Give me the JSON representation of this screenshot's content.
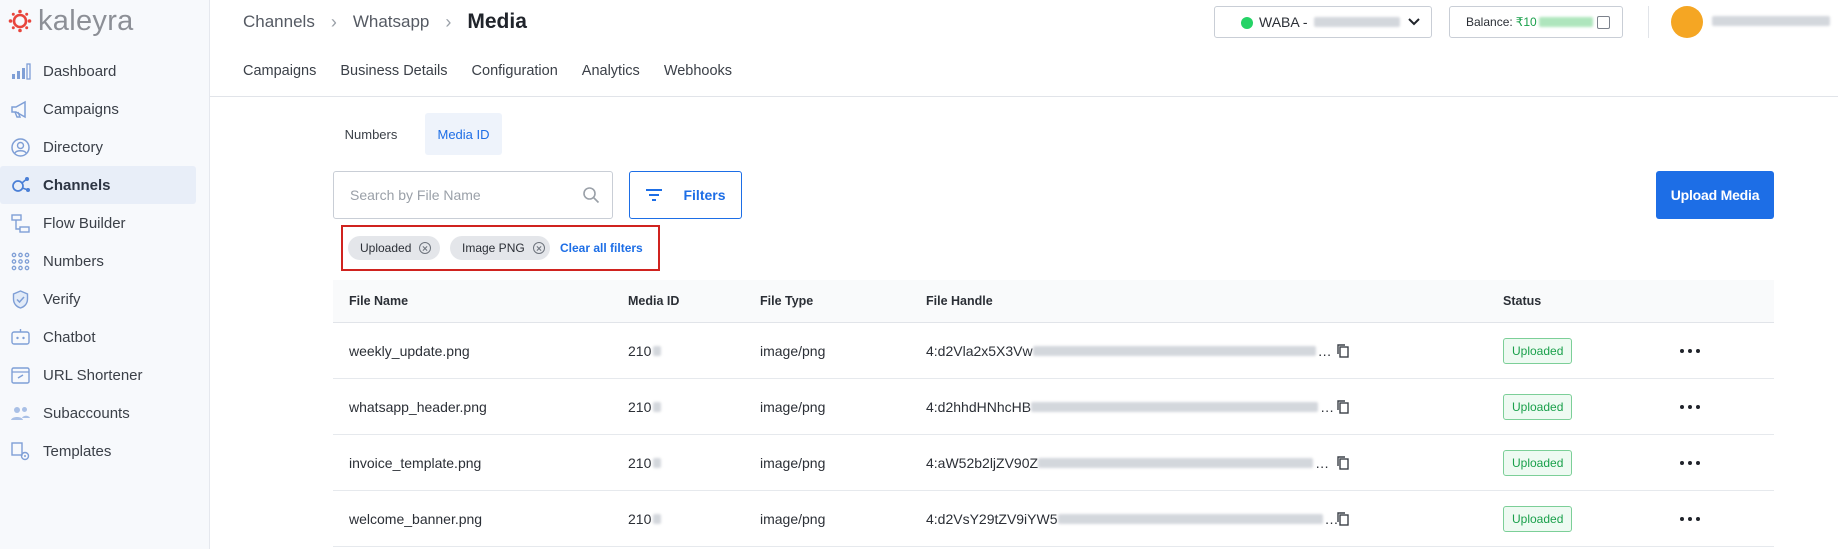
{
  "brand": {
    "name": "kaleyra"
  },
  "sidebar": {
    "items": [
      {
        "label": "Dashboard",
        "icon": "bar-chart-icon"
      },
      {
        "label": "Campaigns",
        "icon": "megaphone-icon"
      },
      {
        "label": "Directory",
        "icon": "person-circle-icon"
      },
      {
        "label": "Channels",
        "icon": "channels-icon",
        "active": true
      },
      {
        "label": "Flow Builder",
        "icon": "flow-icon"
      },
      {
        "label": "Numbers",
        "icon": "dial-grid-icon"
      },
      {
        "label": "Verify",
        "icon": "shield-check-icon"
      },
      {
        "label": "Chatbot",
        "icon": "chatbot-icon"
      },
      {
        "label": "URL Shortener",
        "icon": "link-icon"
      },
      {
        "label": "Subaccounts",
        "icon": "users-icon"
      },
      {
        "label": "Templates",
        "icon": "template-gear-icon"
      }
    ]
  },
  "header": {
    "breadcrumb": [
      "Channels",
      "Whatsapp"
    ],
    "title": "Media",
    "waba_label": "WABA -",
    "balance_label": "Balance:",
    "balance_prefix": "₹10"
  },
  "top_tabs": [
    "Campaigns",
    "Business Details",
    "Configuration",
    "Analytics",
    "Webhooks"
  ],
  "sub_tabs": {
    "numbers": "Numbers",
    "media": "Media ID"
  },
  "search": {
    "placeholder": "Search by File Name"
  },
  "filters_label": "Filters",
  "upload_label": "Upload Media",
  "chips": [
    "Uploaded",
    "Image PNG"
  ],
  "clear_all": "Clear all filters",
  "table": {
    "headers": [
      "File Name",
      "Media ID",
      "File Type",
      "File Handle",
      "Status"
    ],
    "rows": [
      {
        "name": "weekly_update.png",
        "id": "210",
        "type": "image/png",
        "handle": "4:d2Vla2x5X3Vw",
        "status": "Uploaded"
      },
      {
        "name": "whatsapp_header.png",
        "id": "210",
        "type": "image/png",
        "handle": "4:d2hhdHNhcHB",
        "status": "Uploaded"
      },
      {
        "name": "invoice_template.png",
        "id": "210",
        "type": "image/png",
        "handle": "4:aW52b2ljZV90Z",
        "status": "Uploaded"
      },
      {
        "name": "welcome_banner.png",
        "id": "210",
        "type": "image/png",
        "handle": "4:d2VsY29tZV9iYW5",
        "status": "Uploaded"
      }
    ]
  },
  "colors": {
    "accent": "#1d6ee6",
    "success": "#1aa04b",
    "highlight_box": "#d0231f"
  }
}
